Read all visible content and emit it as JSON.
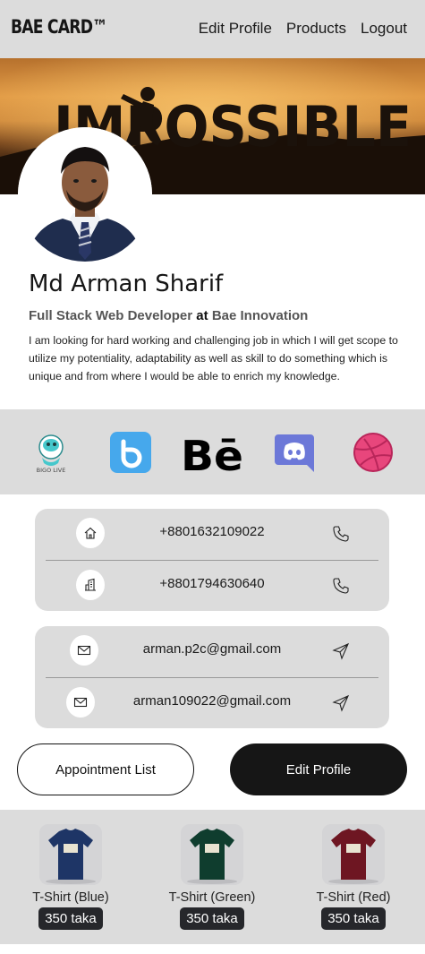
{
  "header": {
    "brand": "BAE CARD™",
    "nav": [
      "Edit Profile",
      "Products",
      "Logout"
    ]
  },
  "cover": {
    "text": "IMPOSSIBLE"
  },
  "profile": {
    "name": "Md Arman Sharif",
    "title": "Full Stack Web Developer",
    "at": "at",
    "company": "Bae Innovation",
    "bio": "I am looking for hard working and challenging job in which I will get scope to utilize my potentiality, adaptability as well as skill to do something which is unique and from where I would be able to enrich my knowledge."
  },
  "social": [
    {
      "name": "bigo-live",
      "label": "BIGO LIVE",
      "color": "#34c2c8"
    },
    {
      "name": "bip",
      "label": "",
      "color": "#46a8ec"
    },
    {
      "name": "behance",
      "label": "Bē",
      "color": "#000000"
    },
    {
      "name": "discord",
      "label": "",
      "color": "#6c78d8"
    },
    {
      "name": "dribbble",
      "label": "",
      "color": "#e8467c"
    }
  ],
  "contacts": {
    "phones": [
      {
        "icon": "home-icon",
        "value": "+8801632109022",
        "action_icon": "phone-icon"
      },
      {
        "icon": "office-building-icon",
        "value": "+8801794630640",
        "action_icon": "phone-icon"
      }
    ],
    "emails": [
      {
        "icon": "envelope-icon",
        "value": "arman.p2c@gmail.com",
        "action_icon": "send-icon"
      },
      {
        "icon": "envelope-icon",
        "value": "arman109022@gmail.com",
        "action_icon": "send-icon"
      }
    ]
  },
  "buttons": {
    "appointment": "Appointment List",
    "edit": "Edit Profile"
  },
  "products": [
    {
      "title": "T-Shirt (Blue)",
      "price": "350 taka",
      "color": "#1e3566"
    },
    {
      "title": "T-Shirt (Green)",
      "price": "350 taka",
      "color": "#0f3d2e"
    },
    {
      "title": "T-Shirt (Red)",
      "price": "350 taka",
      "color": "#6e1622"
    }
  ]
}
